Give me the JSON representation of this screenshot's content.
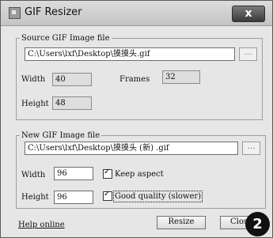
{
  "window": {
    "title": "GIF Resizer",
    "close_label": "x"
  },
  "source": {
    "legend": "Source GIF Image file",
    "path": "C:\\Users\\lxf\\Desktop\\摸摸头.gif",
    "browse_label": "...",
    "width_label": "Width",
    "width_value": "40",
    "frames_label": "Frames",
    "frames_value": "32",
    "height_label": "Height",
    "height_value": "48"
  },
  "new": {
    "legend": "New GIF Image file",
    "path": "C:\\Users\\lxf\\Desktop\\摸摸头 (新) .gif",
    "browse_label": "...",
    "width_label": "Width",
    "width_value": "96",
    "keep_aspect_label": "Keep aspect",
    "keep_aspect_checked": true,
    "height_label": "Height",
    "height_value": "96",
    "good_quality_label": "Good quality (slower)",
    "good_quality_checked": true
  },
  "footer": {
    "help_link": "Help online",
    "resize_label": "Resize",
    "close_label": "Clos"
  },
  "annotation_badge": "2"
}
